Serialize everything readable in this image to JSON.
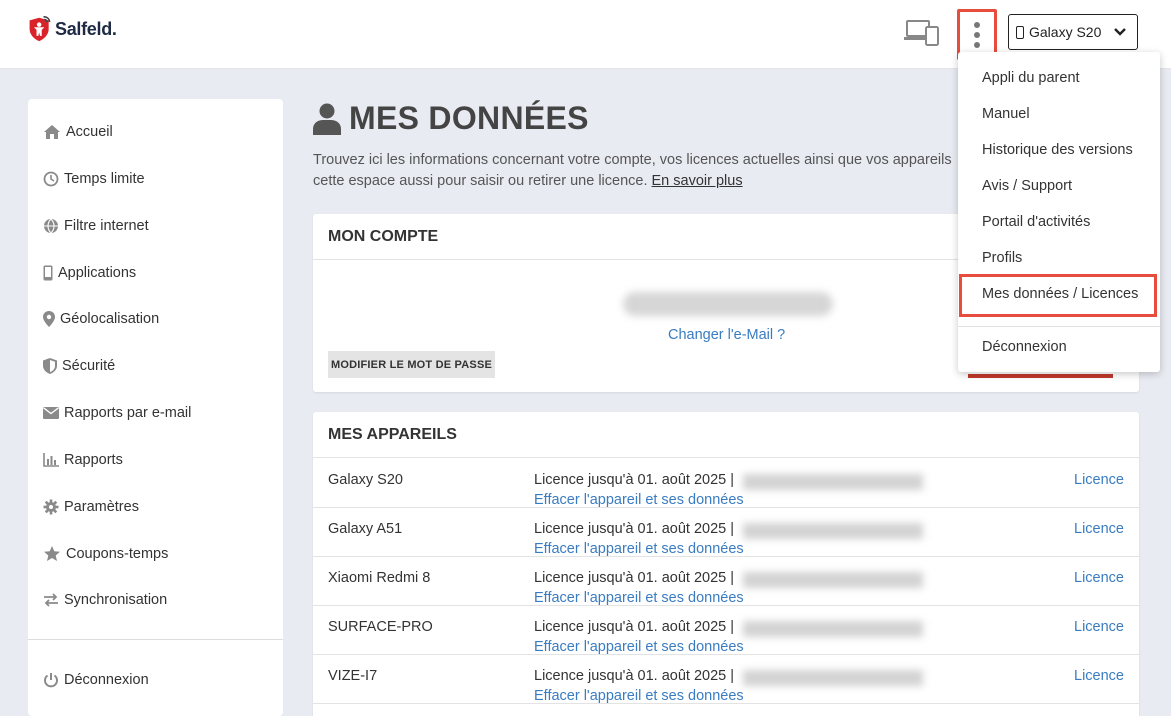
{
  "header": {
    "logo_text": "Salfeld.",
    "device_selector": "Galaxy S20"
  },
  "sidebar": {
    "items": [
      {
        "label": "Accueil",
        "icon": "home-icon"
      },
      {
        "label": "Temps limite",
        "icon": "clock-icon"
      },
      {
        "label": "Filtre internet",
        "icon": "globe-icon"
      },
      {
        "label": "Applications",
        "icon": "phone-icon"
      },
      {
        "label": "Géolocalisation",
        "icon": "map-pin-icon"
      },
      {
        "label": "Sécurité",
        "icon": "shield-icon"
      },
      {
        "label": "Rapports par e-mail",
        "icon": "envelope-icon"
      },
      {
        "label": "Rapports",
        "icon": "bar-chart-icon"
      },
      {
        "label": "Paramètres",
        "icon": "gear-icon"
      },
      {
        "label": "Coupons-temps",
        "icon": "star-icon"
      },
      {
        "label": "Synchronisation",
        "icon": "sync-icon"
      }
    ],
    "logout": "Déconnexion"
  },
  "main": {
    "title": "MES DONNÉES",
    "intro_line1": "Trouvez ici les informations concernant votre compte, vos licences actuelles ainsi que vos appareils",
    "intro_line2": "cette espace aussi pour saisir ou retirer une licence.",
    "intro_link": "En savoir plus",
    "account": {
      "heading": "MON COMPTE",
      "change_email": "Changer l'e-Mail ?",
      "change_password": "MODIFIER LE MOT DE PASSE"
    },
    "devices": {
      "heading": "MES APPAREILS",
      "rows": [
        {
          "name": "Galaxy S20",
          "license": "Licence jusqu'à 01. août 2025 |",
          "erase": "Effacer l'appareil et ses données",
          "link": "Licence"
        },
        {
          "name": "Galaxy A51",
          "license": "Licence jusqu'à 01. août 2025 |",
          "erase": "Effacer l'appareil et ses données",
          "link": "Licence"
        },
        {
          "name": "Xiaomi Redmi 8",
          "license": "Licence jusqu'à 01. août 2025 |",
          "erase": "Effacer l'appareil et ses données",
          "link": "Licence"
        },
        {
          "name": "SURFACE-PRO",
          "license": "Licence jusqu'à 01. août 2025 |",
          "erase": "Effacer l'appareil et ses données",
          "link": "Licence"
        },
        {
          "name": "VIZE-I7",
          "license": "Licence jusqu'à 01. août 2025 |",
          "erase": "Effacer l'appareil et ses données",
          "link": "Licence"
        }
      ]
    }
  },
  "dropdown": {
    "items": [
      "Appli du parent",
      "Manuel",
      "Historique des versions",
      "Avis / Support",
      "Portail d'activités",
      "Profils",
      "Mes données / Licences"
    ],
    "logout": "Déconnexion"
  },
  "colors": {
    "accent_link": "#3a7cc1",
    "highlight": "#e74c3c",
    "logo_red": "#d9222a"
  }
}
